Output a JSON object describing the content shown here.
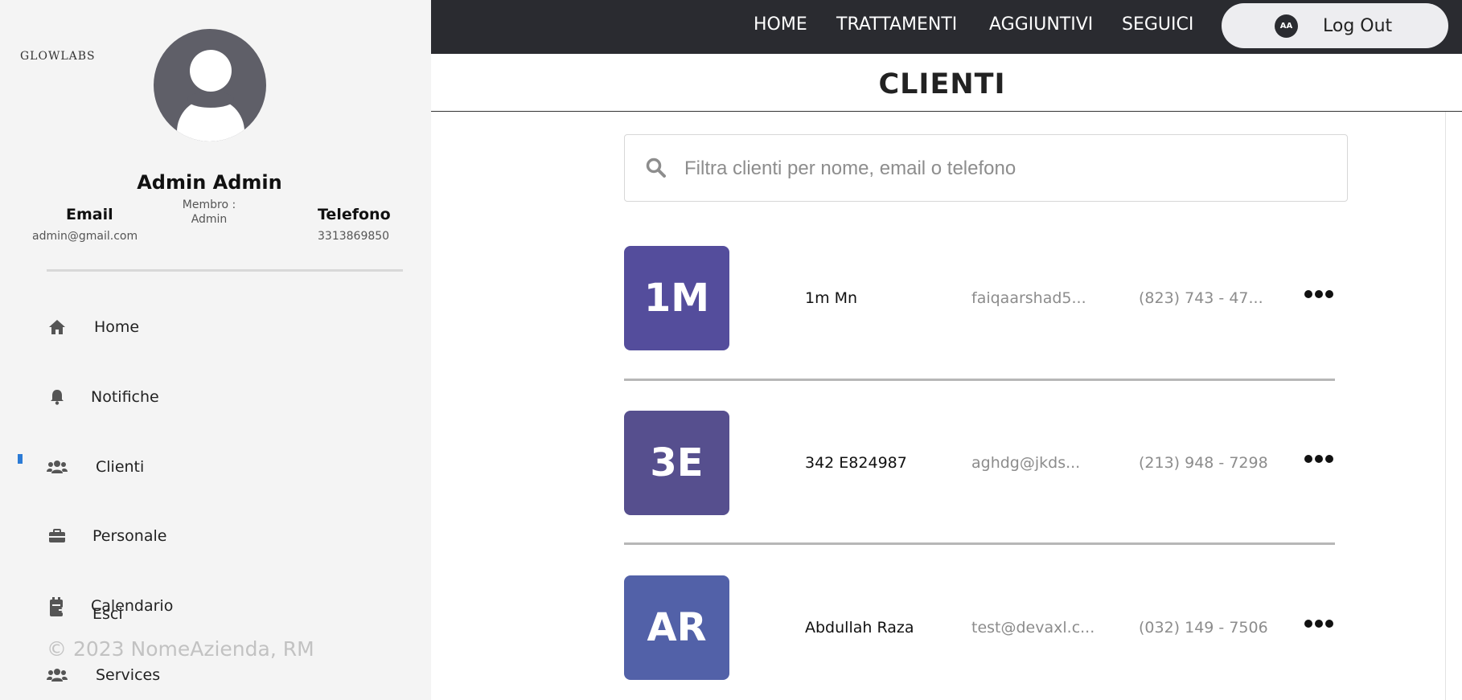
{
  "sidebar": {
    "logo": "GLOWLABS",
    "user_name": "Admin Admin",
    "email_label": "Email",
    "email_value": "admin@gmail.com",
    "member_label": "Membro :",
    "member_value": "Admin",
    "phone_label": "Telefono",
    "phone_value": "3313869850",
    "items": [
      {
        "label": "Home",
        "icon": "home-icon"
      },
      {
        "label": "Notifiche",
        "icon": "bell-icon"
      },
      {
        "label": "Clienti",
        "icon": "users-icon",
        "active": true
      },
      {
        "label": "Personale",
        "icon": "briefcase-icon"
      },
      {
        "label": "Calendario",
        "icon": "calendar-icon"
      },
      {
        "label": "Services",
        "icon": "users-icon"
      }
    ],
    "esci_label": "Esci",
    "footer": "© 2023 NomeAzienda, RM",
    "active_color": "#2b7bd6"
  },
  "topnav": {
    "links": [
      "HOME",
      "TRATTAMENTI",
      "AGGIUNTIVI",
      "SEGUICI"
    ],
    "avatar_initials": "AA",
    "logout_label": "Log Out",
    "bar_color": "#2a2b30"
  },
  "page": {
    "title": "CLIENTI"
  },
  "search": {
    "placeholder": "Filtra clienti per nome, email o telefono",
    "value": ""
  },
  "clients": [
    {
      "initials": "1M",
      "name": "1m Mn",
      "email": "faiqaarshad5...",
      "phone": "(823) 743 - 47...",
      "color": "#544d9c"
    },
    {
      "initials": "3E",
      "name": "342 E824987",
      "email": "aghdg@jkds...",
      "phone": "(213) 948 - 7298",
      "color": "#564f8e"
    },
    {
      "initials": "AR",
      "name": "Abdullah Raza",
      "email": "test@devaxl.c...",
      "phone": "(032) 149 - 7506",
      "color": "#5261a8"
    }
  ]
}
